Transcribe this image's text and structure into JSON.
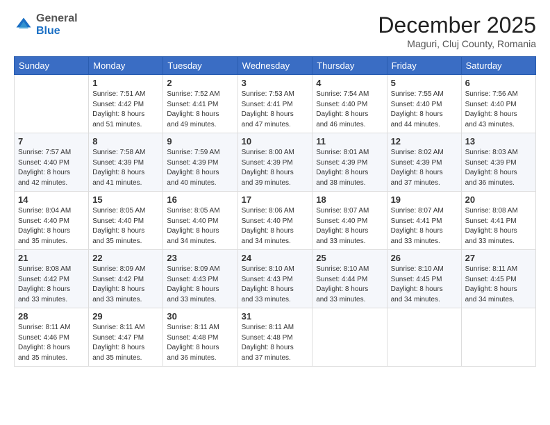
{
  "header": {
    "logo_general": "General",
    "logo_blue": "Blue",
    "month_title": "December 2025",
    "location": "Maguri, Cluj County, Romania"
  },
  "days_of_week": [
    "Sunday",
    "Monday",
    "Tuesday",
    "Wednesday",
    "Thursday",
    "Friday",
    "Saturday"
  ],
  "weeks": [
    [
      {
        "day": "",
        "info": ""
      },
      {
        "day": "1",
        "info": "Sunrise: 7:51 AM\nSunset: 4:42 PM\nDaylight: 8 hours\nand 51 minutes."
      },
      {
        "day": "2",
        "info": "Sunrise: 7:52 AM\nSunset: 4:41 PM\nDaylight: 8 hours\nand 49 minutes."
      },
      {
        "day": "3",
        "info": "Sunrise: 7:53 AM\nSunset: 4:41 PM\nDaylight: 8 hours\nand 47 minutes."
      },
      {
        "day": "4",
        "info": "Sunrise: 7:54 AM\nSunset: 4:40 PM\nDaylight: 8 hours\nand 46 minutes."
      },
      {
        "day": "5",
        "info": "Sunrise: 7:55 AM\nSunset: 4:40 PM\nDaylight: 8 hours\nand 44 minutes."
      },
      {
        "day": "6",
        "info": "Sunrise: 7:56 AM\nSunset: 4:40 PM\nDaylight: 8 hours\nand 43 minutes."
      }
    ],
    [
      {
        "day": "7",
        "info": "Sunrise: 7:57 AM\nSunset: 4:40 PM\nDaylight: 8 hours\nand 42 minutes."
      },
      {
        "day": "8",
        "info": "Sunrise: 7:58 AM\nSunset: 4:39 PM\nDaylight: 8 hours\nand 41 minutes."
      },
      {
        "day": "9",
        "info": "Sunrise: 7:59 AM\nSunset: 4:39 PM\nDaylight: 8 hours\nand 40 minutes."
      },
      {
        "day": "10",
        "info": "Sunrise: 8:00 AM\nSunset: 4:39 PM\nDaylight: 8 hours\nand 39 minutes."
      },
      {
        "day": "11",
        "info": "Sunrise: 8:01 AM\nSunset: 4:39 PM\nDaylight: 8 hours\nand 38 minutes."
      },
      {
        "day": "12",
        "info": "Sunrise: 8:02 AM\nSunset: 4:39 PM\nDaylight: 8 hours\nand 37 minutes."
      },
      {
        "day": "13",
        "info": "Sunrise: 8:03 AM\nSunset: 4:39 PM\nDaylight: 8 hours\nand 36 minutes."
      }
    ],
    [
      {
        "day": "14",
        "info": "Sunrise: 8:04 AM\nSunset: 4:40 PM\nDaylight: 8 hours\nand 35 minutes."
      },
      {
        "day": "15",
        "info": "Sunrise: 8:05 AM\nSunset: 4:40 PM\nDaylight: 8 hours\nand 35 minutes."
      },
      {
        "day": "16",
        "info": "Sunrise: 8:05 AM\nSunset: 4:40 PM\nDaylight: 8 hours\nand 34 minutes."
      },
      {
        "day": "17",
        "info": "Sunrise: 8:06 AM\nSunset: 4:40 PM\nDaylight: 8 hours\nand 34 minutes."
      },
      {
        "day": "18",
        "info": "Sunrise: 8:07 AM\nSunset: 4:40 PM\nDaylight: 8 hours\nand 33 minutes."
      },
      {
        "day": "19",
        "info": "Sunrise: 8:07 AM\nSunset: 4:41 PM\nDaylight: 8 hours\nand 33 minutes."
      },
      {
        "day": "20",
        "info": "Sunrise: 8:08 AM\nSunset: 4:41 PM\nDaylight: 8 hours\nand 33 minutes."
      }
    ],
    [
      {
        "day": "21",
        "info": "Sunrise: 8:08 AM\nSunset: 4:42 PM\nDaylight: 8 hours\nand 33 minutes."
      },
      {
        "day": "22",
        "info": "Sunrise: 8:09 AM\nSunset: 4:42 PM\nDaylight: 8 hours\nand 33 minutes."
      },
      {
        "day": "23",
        "info": "Sunrise: 8:09 AM\nSunset: 4:43 PM\nDaylight: 8 hours\nand 33 minutes."
      },
      {
        "day": "24",
        "info": "Sunrise: 8:10 AM\nSunset: 4:43 PM\nDaylight: 8 hours\nand 33 minutes."
      },
      {
        "day": "25",
        "info": "Sunrise: 8:10 AM\nSunset: 4:44 PM\nDaylight: 8 hours\nand 33 minutes."
      },
      {
        "day": "26",
        "info": "Sunrise: 8:10 AM\nSunset: 4:45 PM\nDaylight: 8 hours\nand 34 minutes."
      },
      {
        "day": "27",
        "info": "Sunrise: 8:11 AM\nSunset: 4:45 PM\nDaylight: 8 hours\nand 34 minutes."
      }
    ],
    [
      {
        "day": "28",
        "info": "Sunrise: 8:11 AM\nSunset: 4:46 PM\nDaylight: 8 hours\nand 35 minutes."
      },
      {
        "day": "29",
        "info": "Sunrise: 8:11 AM\nSunset: 4:47 PM\nDaylight: 8 hours\nand 35 minutes."
      },
      {
        "day": "30",
        "info": "Sunrise: 8:11 AM\nSunset: 4:48 PM\nDaylight: 8 hours\nand 36 minutes."
      },
      {
        "day": "31",
        "info": "Sunrise: 8:11 AM\nSunset: 4:48 PM\nDaylight: 8 hours\nand 37 minutes."
      },
      {
        "day": "",
        "info": ""
      },
      {
        "day": "",
        "info": ""
      },
      {
        "day": "",
        "info": ""
      }
    ]
  ]
}
